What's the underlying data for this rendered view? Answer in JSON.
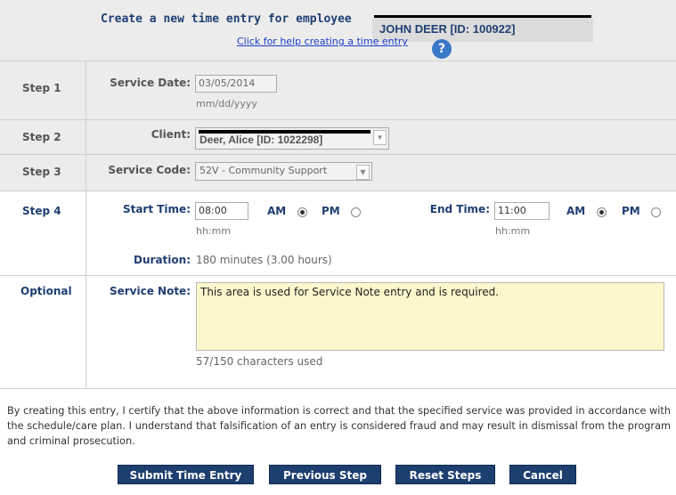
{
  "header": {
    "title": "Create a new time entry for employee",
    "employee": "JOHN DEER  [ID: 100922]",
    "help_link": "Click for help creating a time entry",
    "help_icon": "?"
  },
  "steps": {
    "step1": {
      "label": "Step 1",
      "field_label": "Service Date:",
      "value": "03/05/2014",
      "hint": "mm/dd/yyyy"
    },
    "step2": {
      "label": "Step 2",
      "field_label": "Client:",
      "value": "Deer, Alice  [ID: 1022298]"
    },
    "step3": {
      "label": "Step 3",
      "field_label": "Service Code:",
      "value": "52V - Community Support"
    },
    "step4": {
      "label": "Step 4",
      "start_label": "Start Time:",
      "start_value": "08:00",
      "start_hint": "hh:mm",
      "end_label": "End Time:",
      "end_value": "11:00",
      "end_hint": "hh:mm",
      "am": "AM",
      "pm": "PM",
      "start_selected": "AM",
      "end_selected": "AM",
      "duration_label": "Duration:",
      "duration_value": "180 minutes (3.00 hours)"
    },
    "optional": {
      "label": "Optional",
      "field_label": "Service Note:",
      "value": "This area is used for Service Note entry and is required.",
      "counter": "57/150 characters used"
    }
  },
  "certification": "By creating this entry, I certify that the above information is correct and that the specified service was provided in accordance with the schedule/care plan. I understand that falsification of an entry is considered fraud and may result in dismissal from the program and criminal prosecution.",
  "buttons": {
    "submit": "Submit Time Entry",
    "previous": "Previous Step",
    "reset": "Reset Steps",
    "cancel": "Cancel"
  },
  "colors": {
    "accent": "#1f3f73",
    "note_background": "#fdf8cc",
    "button": "#1d3f70"
  }
}
